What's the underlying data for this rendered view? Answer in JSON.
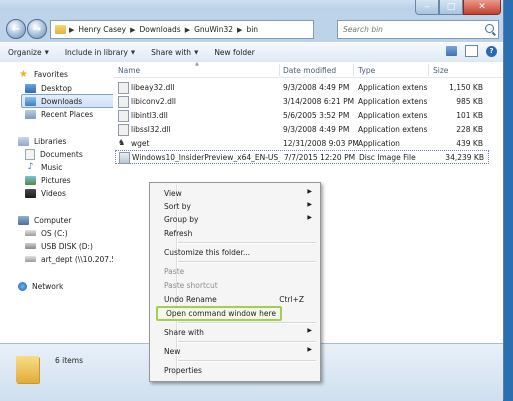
{
  "window": {
    "caption": {
      "minimize": "‒",
      "maximize": "□",
      "close": "✕"
    }
  },
  "address": {
    "segments": [
      "Henry Casey",
      "Downloads",
      "GnuWin32",
      "bin"
    ],
    "search_placeholder": "Search bin"
  },
  "toolbar": {
    "organize": "Organize",
    "include_in_library": "Include in library",
    "share_with": "Share with",
    "new_folder": "New folder"
  },
  "nav": {
    "favorites": "Favorites",
    "desktop": "Desktop",
    "downloads": "Downloads",
    "recent_places": "Recent Places",
    "libraries": "Libraries",
    "documents": "Documents",
    "music": "Music",
    "pictures": "Pictures",
    "videos": "Videos",
    "computer": "Computer",
    "os_c": "OS (C:)",
    "usb_disk": "USB DISK (D:)",
    "art_dept": "art_dept (\\\\10.207.52",
    "network": "Network"
  },
  "columns": {
    "name": "Name",
    "date_modified": "Date modified",
    "type": "Type",
    "size": "Size"
  },
  "files": [
    {
      "name": "libeay32.dll",
      "date": "9/3/2008 4:49 PM",
      "type": "Application extens...",
      "size": "1,150 KB"
    },
    {
      "name": "libiconv2.dll",
      "date": "3/14/2008 6:21 PM",
      "type": "Application extens...",
      "size": "985 KB"
    },
    {
      "name": "libintl3.dll",
      "date": "5/6/2005 3:52 PM",
      "type": "Application extens...",
      "size": "101 KB"
    },
    {
      "name": "libssl32.dll",
      "date": "9/3/2008 4:49 PM",
      "type": "Application extens...",
      "size": "228 KB"
    },
    {
      "name": "wget",
      "date": "12/31/2008 9:03 PM",
      "type": "Application",
      "size": "439 KB"
    },
    {
      "name": "Windows10_InsiderPreview_x64_EN-US_1...",
      "date": "7/7/2015 12:20 PM",
      "type": "Disc Image File",
      "size": "34,239 KB"
    }
  ],
  "status": {
    "count": "6 items"
  },
  "context_menu": {
    "view": "View",
    "sort_by": "Sort by",
    "group_by": "Group by",
    "refresh": "Refresh",
    "customize": "Customize this folder...",
    "paste": "Paste",
    "paste_shortcut": "Paste shortcut",
    "undo_rename": "Undo Rename",
    "undo_shortcut": "Ctrl+Z",
    "open_cmd": "Open command window here",
    "share_with": "Share with",
    "new": "New",
    "properties": "Properties"
  },
  "colors": {
    "highlight_border": "#9fd14f",
    "selection": "#cfe0f7"
  }
}
